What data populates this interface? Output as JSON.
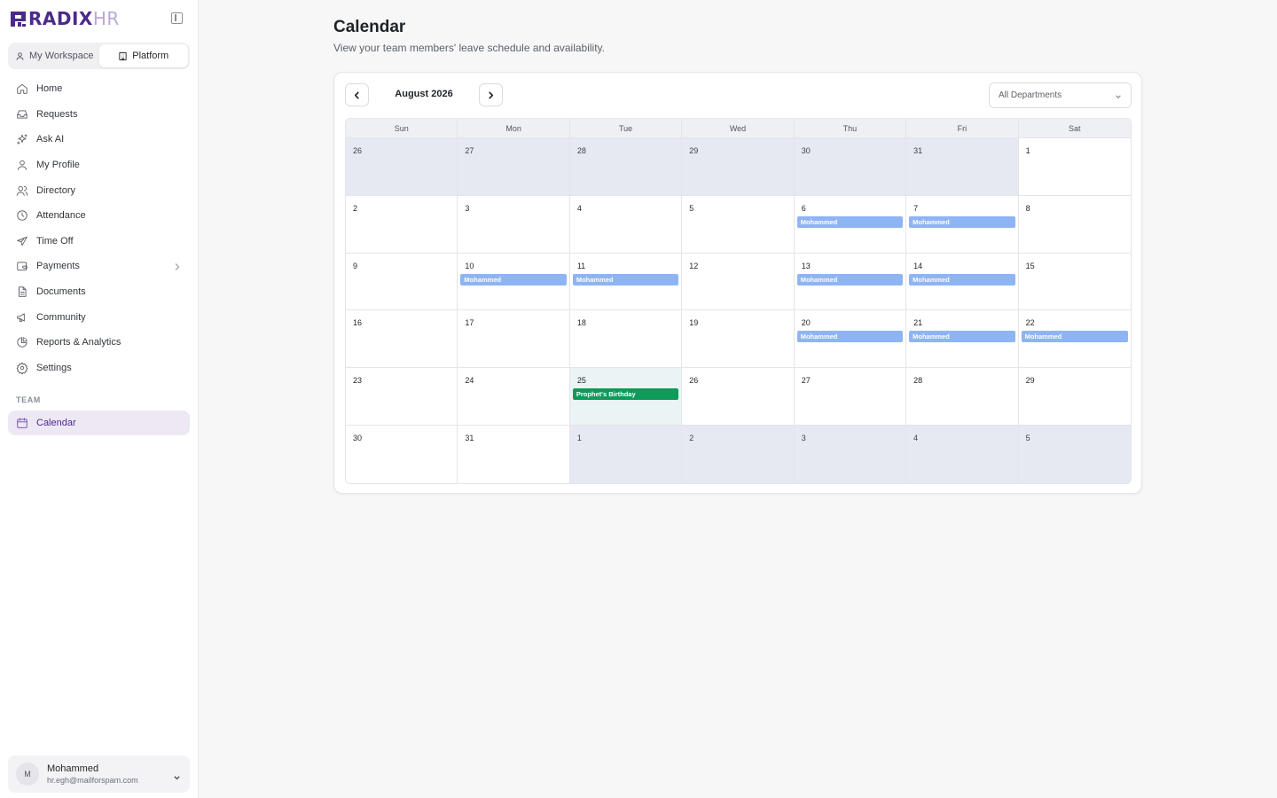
{
  "brand": {
    "name": "RADIX",
    "suffix": "HR"
  },
  "workspace": {
    "tabs": [
      {
        "label": "My Workspace",
        "icon": "user-icon"
      },
      {
        "label": "Platform",
        "icon": "building-icon"
      }
    ],
    "active": "Platform"
  },
  "sidebar": {
    "items": [
      {
        "label": "Home",
        "icon": "home-icon"
      },
      {
        "label": "Requests",
        "icon": "inbox-icon"
      },
      {
        "label": "Ask AI",
        "icon": "sparkles-icon"
      },
      {
        "label": "My Profile",
        "icon": "user-icon"
      },
      {
        "label": "Directory",
        "icon": "users-icon"
      },
      {
        "label": "Attendance",
        "icon": "clock-icon"
      },
      {
        "label": "Time Off",
        "icon": "plane-icon"
      },
      {
        "label": "Payments",
        "icon": "wallet-icon"
      },
      {
        "label": "Documents",
        "icon": "document-icon"
      },
      {
        "label": "Community",
        "icon": "megaphone-icon"
      },
      {
        "label": "Reports & Analytics",
        "icon": "pie-chart-icon"
      },
      {
        "label": "Settings",
        "icon": "gear-icon"
      }
    ],
    "section_label": "TEAM",
    "team_items": [
      {
        "label": "Calendar",
        "icon": "calendar-icon",
        "active": true
      }
    ]
  },
  "user": {
    "initial": "M",
    "name": "Mohammed",
    "email": "hr.egh@mailforspam.com"
  },
  "page": {
    "title": "Calendar",
    "subtitle": "View your team members' leave schedule and availability."
  },
  "calendar": {
    "month_label": "August 2026",
    "department_filter": "All Departments",
    "weekdays": [
      "Sun",
      "Mon",
      "Tue",
      "Wed",
      "Thu",
      "Fri",
      "Sat"
    ],
    "days": [
      {
        "day": "26",
        "outside": true
      },
      {
        "day": "27",
        "outside": true
      },
      {
        "day": "28",
        "outside": true
      },
      {
        "day": "29",
        "outside": true
      },
      {
        "day": "30",
        "outside": true
      },
      {
        "day": "31",
        "outside": true
      },
      {
        "day": "1"
      },
      {
        "day": "2"
      },
      {
        "day": "3"
      },
      {
        "day": "4"
      },
      {
        "day": "5"
      },
      {
        "day": "6",
        "event": "Mohammed",
        "event_type": "leave"
      },
      {
        "day": "7",
        "event": "Mohammed",
        "event_type": "leave"
      },
      {
        "day": "8"
      },
      {
        "day": "9"
      },
      {
        "day": "10",
        "event": "Mohammed",
        "event_type": "leave"
      },
      {
        "day": "11",
        "event": "Mohammed",
        "event_type": "leave"
      },
      {
        "day": "12"
      },
      {
        "day": "13",
        "event": "Mohammed",
        "event_type": "leave"
      },
      {
        "day": "14",
        "event": "Mohammed",
        "event_type": "leave"
      },
      {
        "day": "15"
      },
      {
        "day": "16"
      },
      {
        "day": "17"
      },
      {
        "day": "18"
      },
      {
        "day": "19"
      },
      {
        "day": "20",
        "event": "Mohammed",
        "event_type": "leave"
      },
      {
        "day": "21",
        "event": "Mohammed",
        "event_type": "leave"
      },
      {
        "day": "22",
        "event": "Mohammed",
        "event_type": "leave"
      },
      {
        "day": "23"
      },
      {
        "day": "24"
      },
      {
        "day": "25",
        "today": true,
        "event": "Prophet's Birthday",
        "event_type": "holiday"
      },
      {
        "day": "26"
      },
      {
        "day": "27"
      },
      {
        "day": "28"
      },
      {
        "day": "29"
      },
      {
        "day": "30"
      },
      {
        "day": "31"
      },
      {
        "day": "1",
        "outside": true
      },
      {
        "day": "2",
        "outside": true
      },
      {
        "day": "3",
        "outside": true
      },
      {
        "day": "4",
        "outside": true
      },
      {
        "day": "5",
        "outside": true
      }
    ]
  },
  "colors": {
    "brand": "#4b2a8a",
    "leave": "#8eb4f5",
    "holiday": "#0f9a5a",
    "active_nav_bg": "#eee8f5"
  }
}
